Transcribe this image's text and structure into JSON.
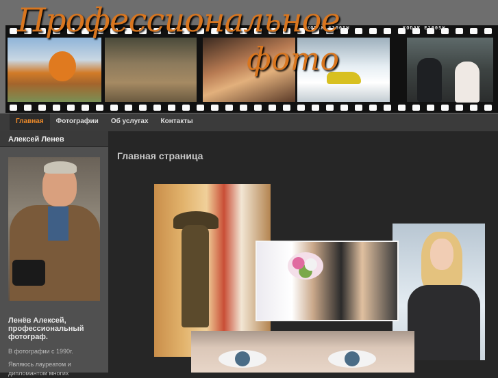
{
  "header": {
    "title_line1": "Профессиональное",
    "title_line2": "фото",
    "film_mark": "KODAK  E100SW"
  },
  "nav": {
    "items": [
      {
        "label": "Главная",
        "active": true
      },
      {
        "label": "Фотографии",
        "active": false
      },
      {
        "label": "Об услугах",
        "active": false
      },
      {
        "label": "Контакты",
        "active": false
      }
    ]
  },
  "sidebar": {
    "title": "Алексей Ленев",
    "author_name": "  Ленёв Алексей, профессиональный фотограф.",
    "author_text_1": "В фотографии с 1990г.",
    "author_text_2": "Являюсь лауреатом и дипломантом многих"
  },
  "main": {
    "page_title": "Главная страница"
  },
  "colors": {
    "accent": "#d9761f",
    "nav_bg": "#3b3b3b",
    "sidebar_bg": "#505050",
    "main_bg": "#262626"
  }
}
